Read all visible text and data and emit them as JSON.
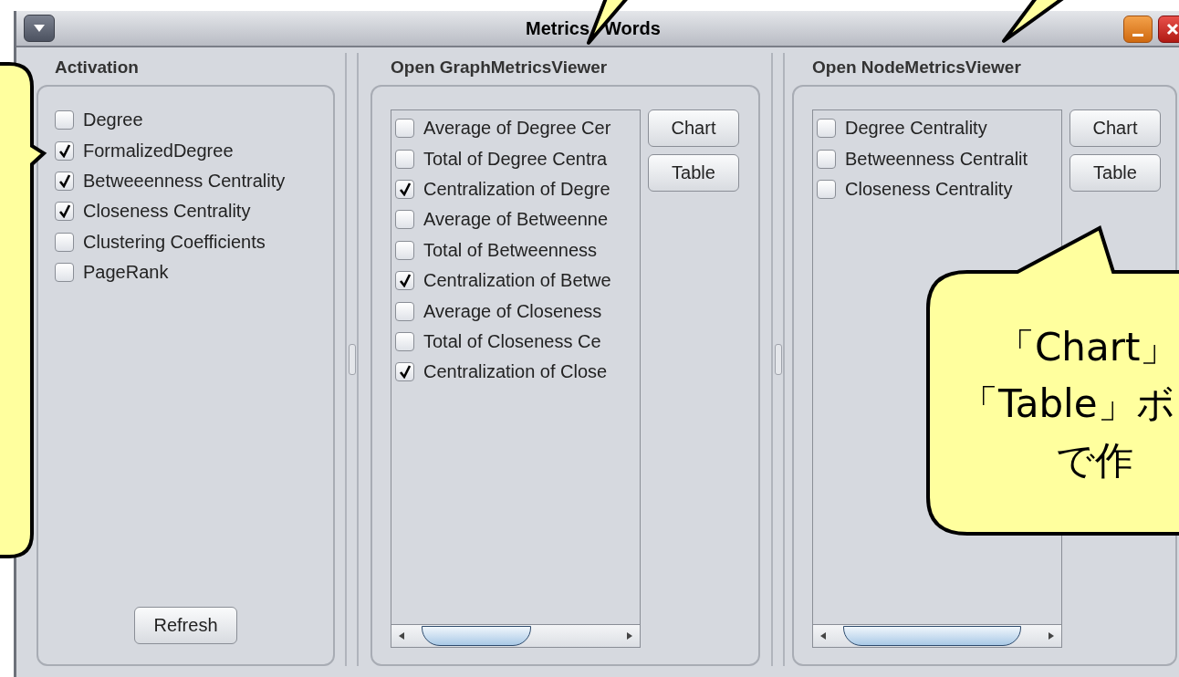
{
  "window": {
    "title_parts": [
      "Metrics",
      "Words"
    ]
  },
  "activation": {
    "title": "Activation",
    "items": [
      {
        "label": "Degree",
        "checked": false
      },
      {
        "label": "FormalizedDegree",
        "checked": true
      },
      {
        "label": "Betweeenness Centrality",
        "checked": true
      },
      {
        "label": "Closeness Centrality",
        "checked": true
      },
      {
        "label": "Clustering Coefficients",
        "checked": false
      },
      {
        "label": "PageRank",
        "checked": false
      }
    ],
    "button": "Refresh"
  },
  "graph_viewer": {
    "title": "Open GraphMetricsViewer",
    "items": [
      {
        "label": "Average of Degree Cer",
        "checked": false
      },
      {
        "label": "Total of Degree Centra",
        "checked": false
      },
      {
        "label": "Centralization of Degre",
        "checked": true
      },
      {
        "label": "Average of Betweenne",
        "checked": false
      },
      {
        "label": "Total of Betweenness",
        "checked": false
      },
      {
        "label": "Centralization of Betwe",
        "checked": true
      },
      {
        "label": "Average of Closeness",
        "checked": false
      },
      {
        "label": "Total of Closeness Ce",
        "checked": false
      },
      {
        "label": "Centralization of Close",
        "checked": true
      }
    ],
    "buttons": [
      "Chart",
      "Table"
    ]
  },
  "node_viewer": {
    "title": "Open NodeMetricsViewer",
    "items": [
      {
        "label": "Degree Centrality",
        "checked": false
      },
      {
        "label": "Betweenness Centralit",
        "checked": false
      },
      {
        "label": "Closeness Centrality",
        "checked": false
      }
    ],
    "buttons": [
      "Chart",
      "Table"
    ]
  },
  "callout": {
    "lines": [
      "「Chart」",
      "「Table」ボ",
      "で作"
    ]
  }
}
